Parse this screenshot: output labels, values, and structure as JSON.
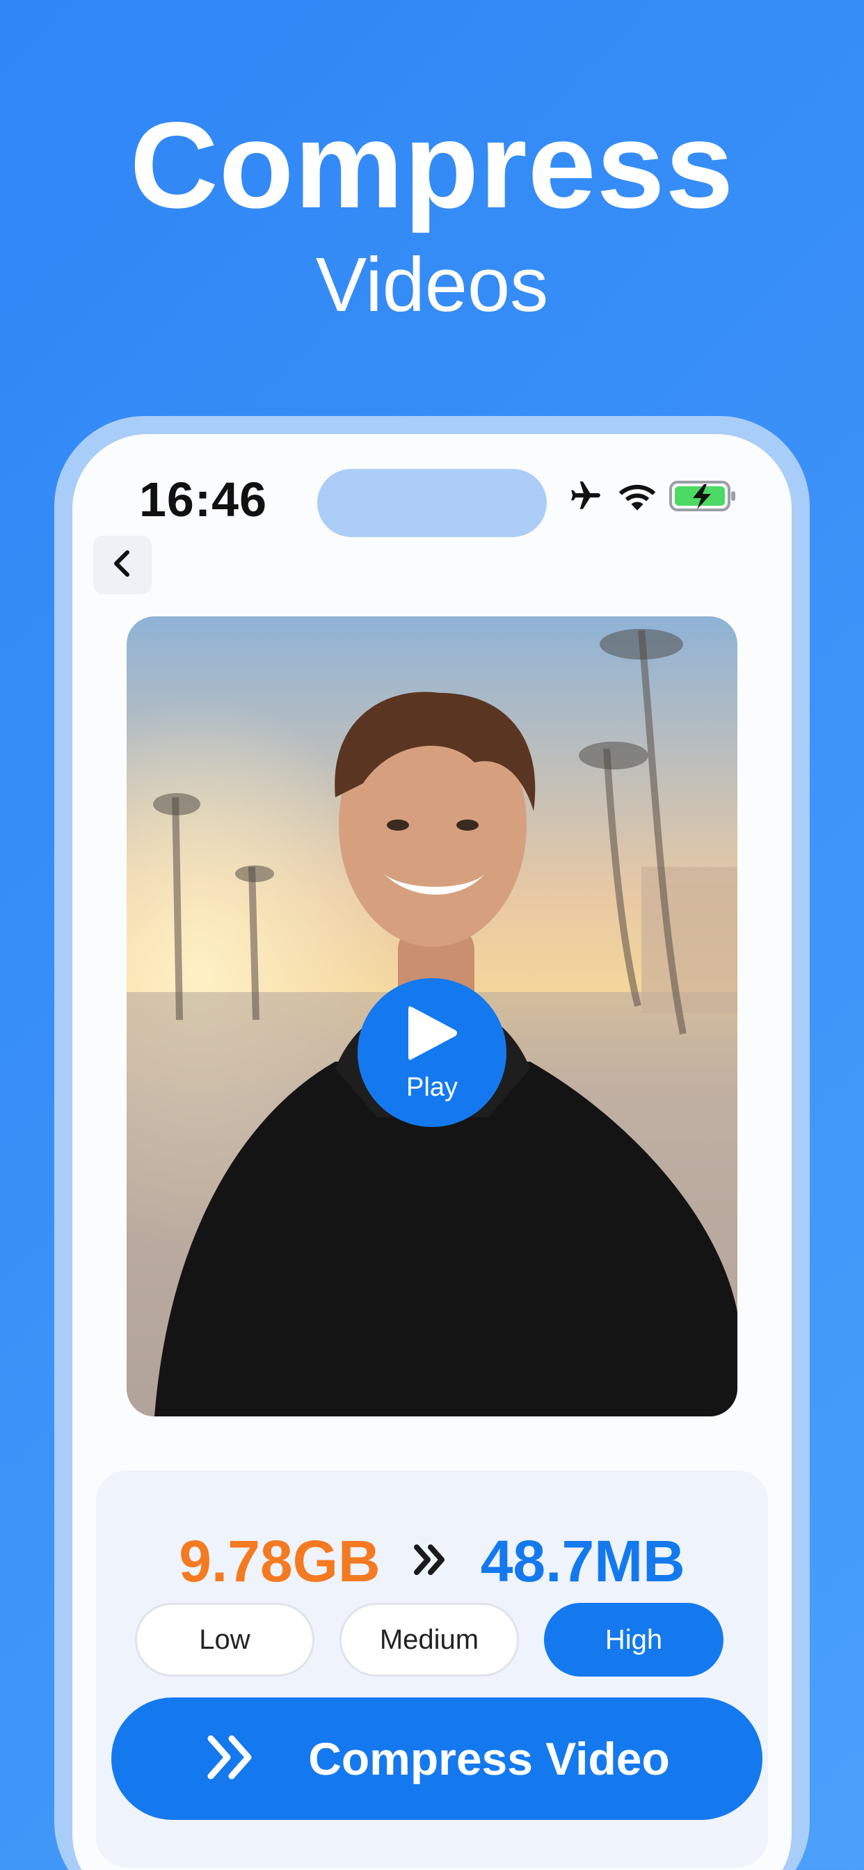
{
  "hero": {
    "title": "Compress",
    "subtitle": "Videos"
  },
  "status_bar": {
    "time": "16:46",
    "icons": [
      "airplane-icon",
      "wifi-icon",
      "battery-charging-icon"
    ]
  },
  "nav": {
    "back_icon": "chevron-left-icon"
  },
  "video": {
    "play_label": "Play",
    "description": "photo of smiling young man in black hoodie on beach promenade at sunset"
  },
  "compression": {
    "original_size": "9.78GB",
    "arrow_icon": "double-chevron-right-icon",
    "compressed_size": "48.7MB",
    "quality_options": [
      {
        "label": "Low",
        "selected": false
      },
      {
        "label": "Medium",
        "selected": false
      },
      {
        "label": "High",
        "selected": true
      }
    ],
    "compress_button_label": "Compress Video"
  },
  "colors": {
    "accent": "#1479ee",
    "original_size": "#f47a22",
    "background": "#3a90f7"
  }
}
